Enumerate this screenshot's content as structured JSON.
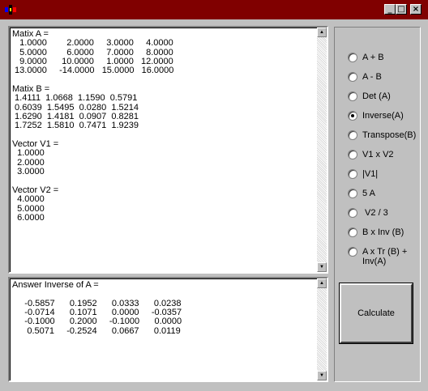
{
  "window": {
    "minimize_glyph": "_",
    "maximize_glyph": "□",
    "close_glyph": "×"
  },
  "input_text": "Matix A =\n   1.0000        2.0000     3.0000     4.0000\n   5.0000        6.0000     7.0000     8.0000\n   9.0000      10.0000     1.0000   12.0000\n 13.0000     -14.0000   15.0000   16.0000\n\nMatix B =\n 1.4111  1.0668  1.1590  0.5791\n 0.6039  1.5495  0.0280  1.5214\n 1.6290  1.4181  0.0907  0.8281\n 1.7252  1.5810  0.7471  1.9239\n\nVector V1 =\n  1.0000\n  2.0000\n  3.0000\n\nVector V2 =\n  4.0000\n  5.0000\n  6.0000",
  "answer_text": "Answer Inverse of A =\n\n     -0.5857      0.1952      0.0333      0.0238\n     -0.0714      0.1071      0.0000     -0.0357\n     -0.1000      0.2000     -0.1000      0.0000\n      0.5071     -0.2524      0.0667      0.0119",
  "operations": [
    {
      "label": "A + B",
      "checked": false
    },
    {
      "label": "A - B",
      "checked": false
    },
    {
      "label": "Det (A)",
      "checked": false
    },
    {
      "label": "Inverse(A)",
      "checked": true
    },
    {
      "label": "Transpose(B)",
      "checked": false
    },
    {
      "label": "V1 x V2",
      "checked": false
    },
    {
      "label": "|V1|",
      "checked": false
    },
    {
      "label": "5 A",
      "checked": false
    },
    {
      "label": " V2 / 3",
      "checked": false
    },
    {
      "label": "B x Inv (B)",
      "checked": false
    },
    {
      "label": "A x Tr (B) +\nInv(A)",
      "checked": false
    }
  ],
  "calculate_label": "Calculate",
  "scroll_up_glyph": "▲",
  "scroll_down_glyph": "▼",
  "colors": {
    "titlebar": "#800000",
    "face": "#c0c0c0"
  }
}
